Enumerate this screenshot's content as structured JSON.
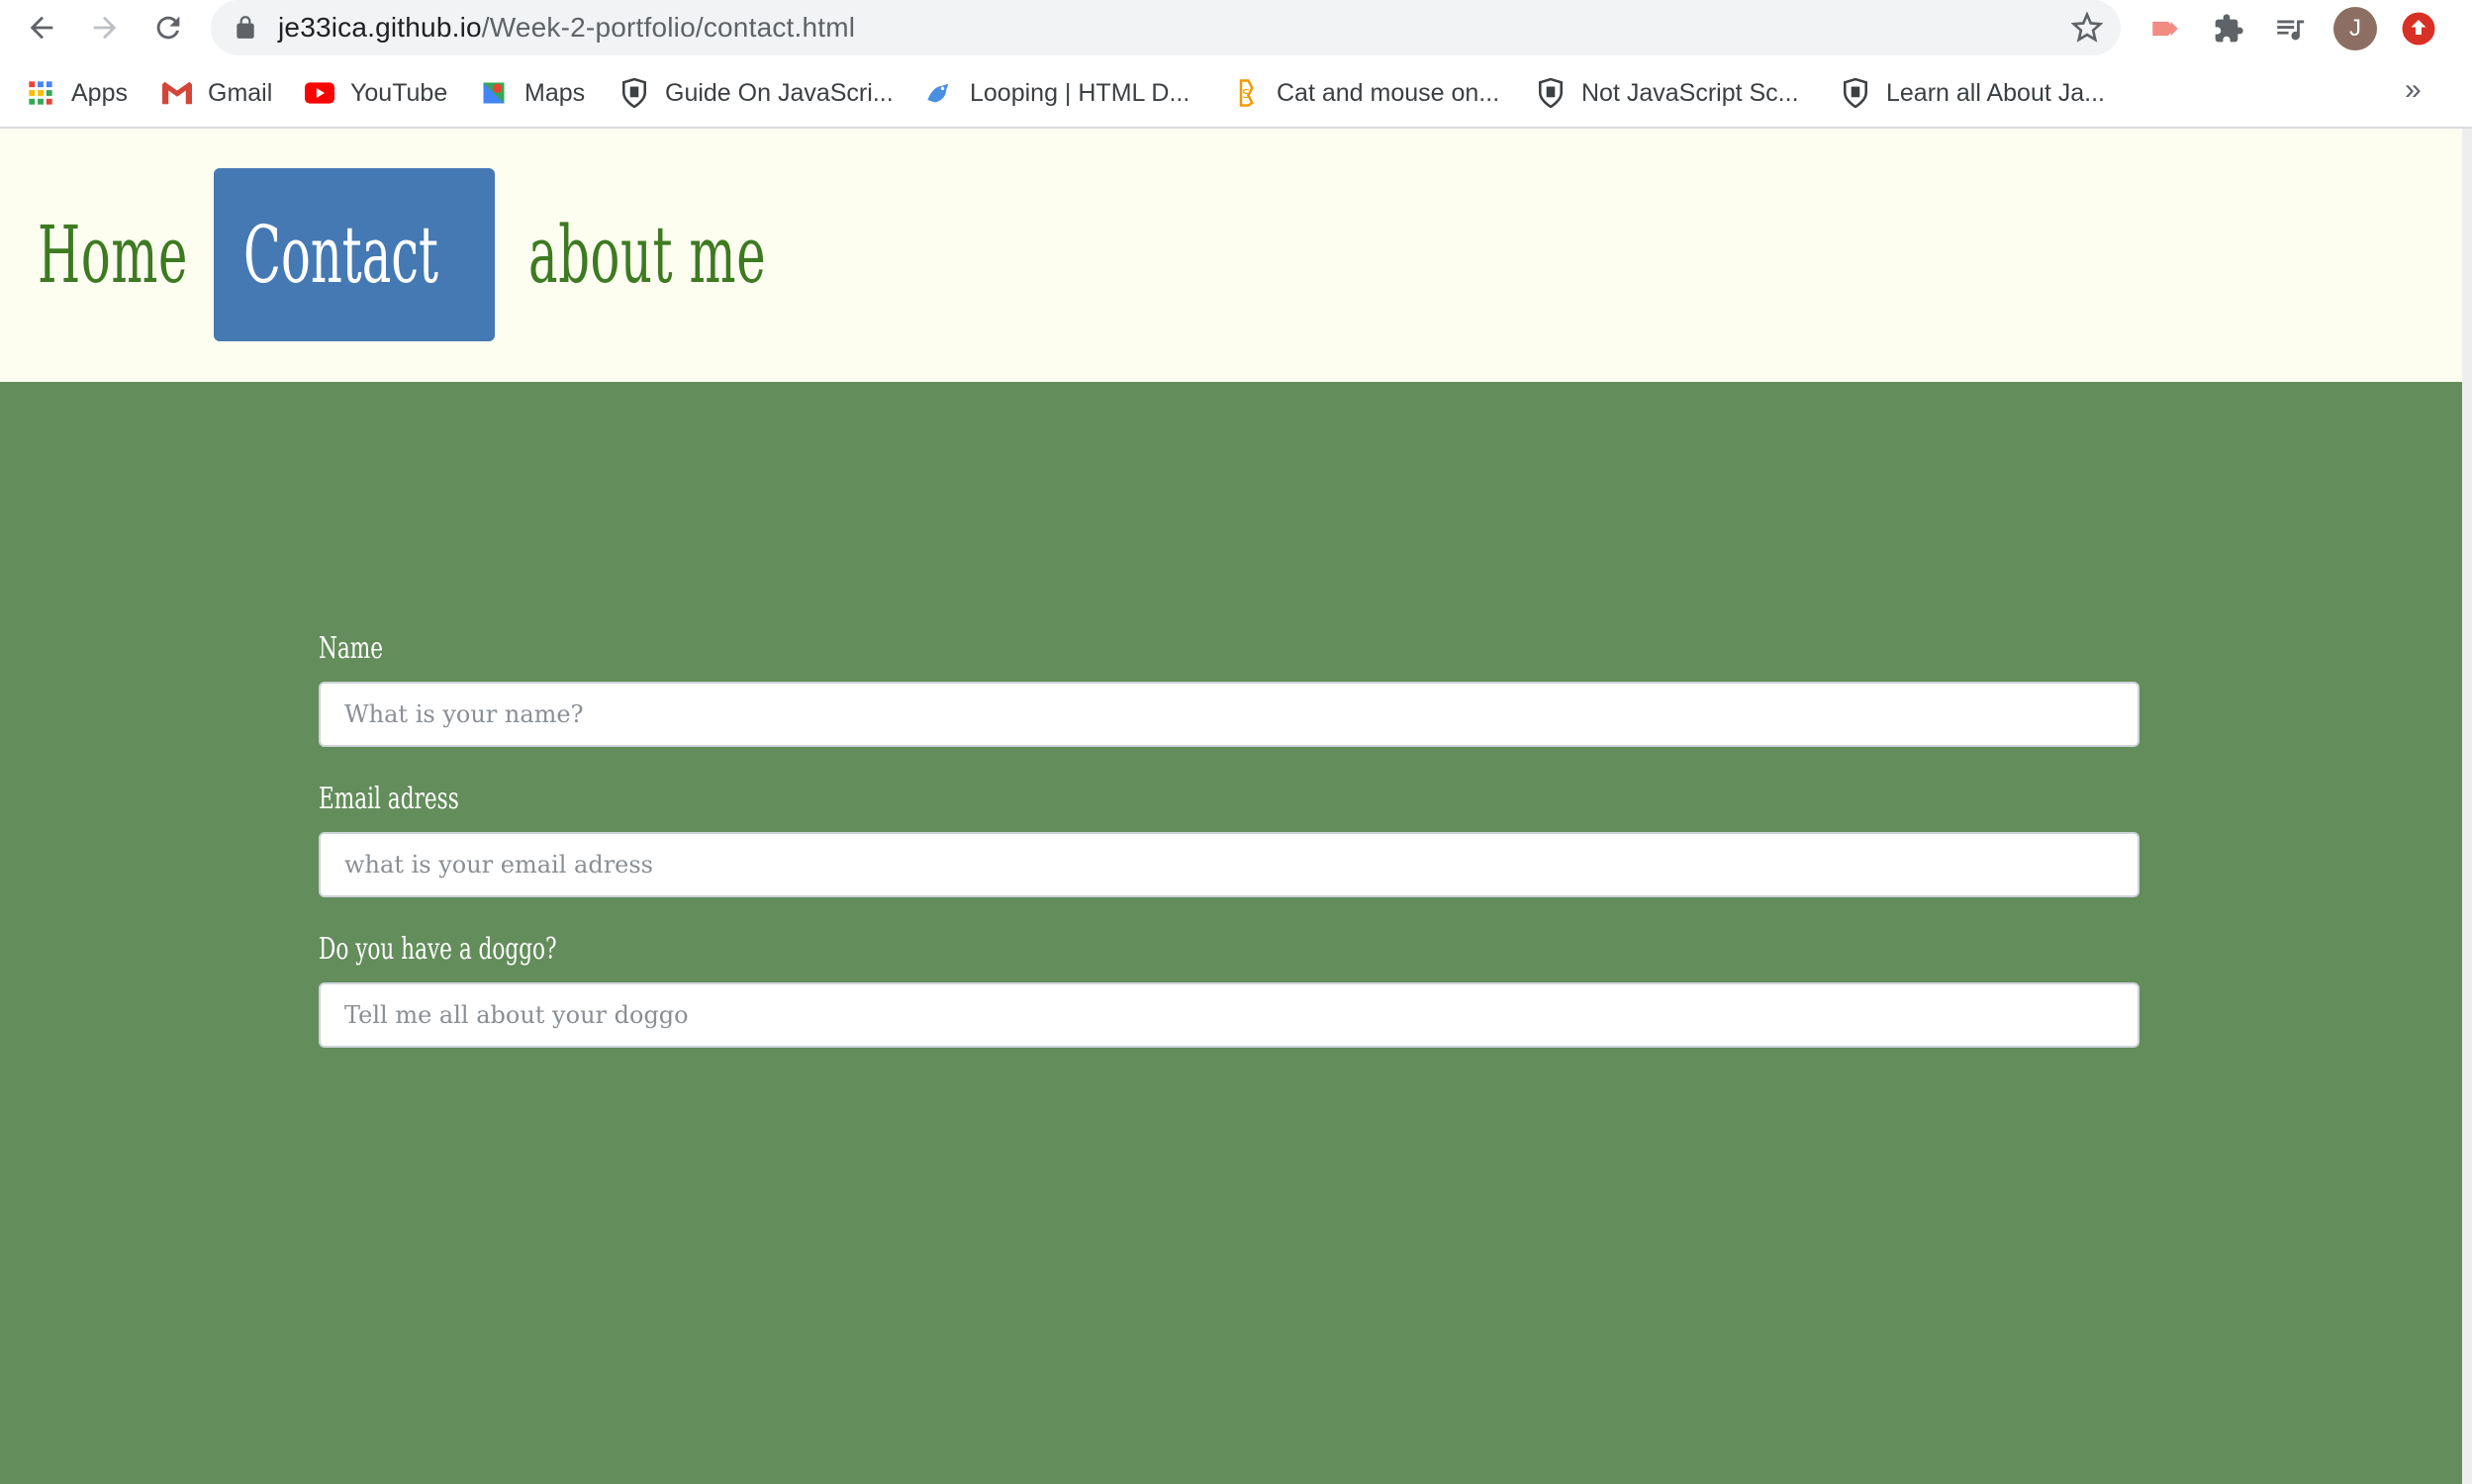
{
  "browser": {
    "url_domain": "je33ica.github.io",
    "url_path": "/Week-2-portfolio/contact.html",
    "avatar_letter": "J",
    "bookmarks": [
      {
        "label": "Apps",
        "icon": "apps-grid-icon"
      },
      {
        "label": "Gmail",
        "icon": "gmail-icon"
      },
      {
        "label": "YouTube",
        "icon": "youtube-icon"
      },
      {
        "label": "Maps",
        "icon": "maps-icon"
      },
      {
        "label": "Guide On JavaScri...",
        "icon": "shield-icon"
      },
      {
        "label": "Looping | HTML D...",
        "icon": "html-dog-icon"
      },
      {
        "label": "Cat and mouse on...",
        "icon": "bookmark-site-icon"
      },
      {
        "label": "Not JavaScript Sc...",
        "icon": "shield-icon"
      },
      {
        "label": "Learn all About Ja...",
        "icon": "shield-icon"
      }
    ],
    "more_bookmarks": "»"
  },
  "nav": {
    "home": "Home",
    "contact": "Contact",
    "about": "about me"
  },
  "form": {
    "name_label": "Name",
    "name_placeholder": "What is your name?",
    "email_label": "Email adress",
    "email_placeholder": "what is your email adress",
    "doggo_label": "Do you have a doggo?",
    "doggo_placeholder": "Tell me all about your doggo"
  },
  "colors": {
    "header_bg": "#fdfdf0",
    "nav_text": "#3d7a22",
    "nav_active_bg": "#4579b3",
    "main_bg": "#638d5b"
  }
}
